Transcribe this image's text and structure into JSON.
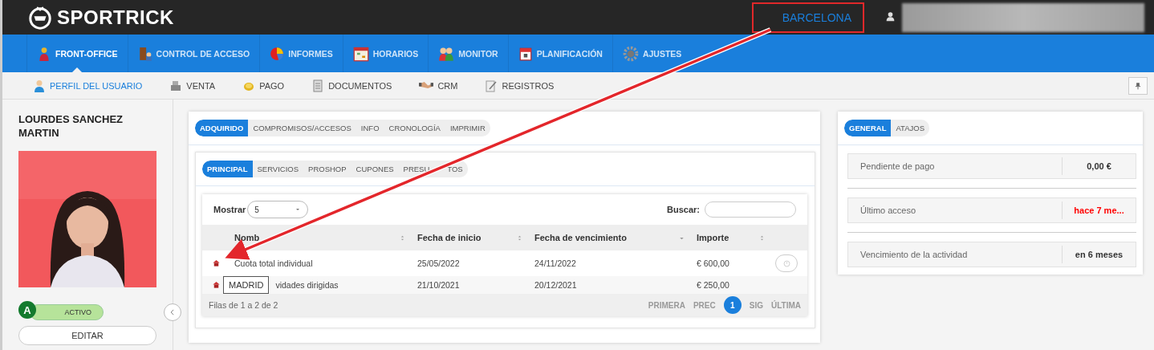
{
  "header": {
    "logo": "SPORTRICK",
    "location": "BARCELONA",
    "location_highlighted": true
  },
  "nav": [
    {
      "label": "FRONT-OFFICE",
      "selected": true
    },
    {
      "label": "CONTROL DE ACCESO",
      "selected": false
    },
    {
      "label": "INFORMES",
      "selected": false
    },
    {
      "label": "HORARIOS",
      "selected": false
    },
    {
      "label": "MONITOR",
      "selected": false
    },
    {
      "label": "PLANIFICACIÓN",
      "selected": false
    },
    {
      "label": "AJUSTES",
      "selected": false
    }
  ],
  "subnav": [
    {
      "label": "PERFIL DEL USUARIO",
      "selected": true
    },
    {
      "label": "VENTA",
      "selected": false
    },
    {
      "label": "PAGO",
      "selected": false
    },
    {
      "label": "DOCUMENTOS",
      "selected": false
    },
    {
      "label": "CRM",
      "selected": false
    },
    {
      "label": "REGISTROS",
      "selected": false
    }
  ],
  "profile": {
    "name": "LOURDES SANCHEZ MARTIN",
    "badge": "A",
    "status": "ACTIVO",
    "active": true,
    "edit": "EDITAR"
  },
  "main": {
    "tabs": [
      {
        "label": "ADQUIRIDO",
        "selected": true
      },
      {
        "label": "COMPROMISOS/ACCESOS",
        "selected": false
      },
      {
        "label": "INFO",
        "selected": false
      },
      {
        "label": "CRONOLOGÍA",
        "selected": false
      },
      {
        "label": "IMPRIMIR",
        "selected": false
      }
    ],
    "subtabs": [
      {
        "label": "PRINCIPAL",
        "selected": true
      },
      {
        "label": "SERVICIOS",
        "selected": false
      },
      {
        "label": "PROSHOP",
        "selected": false
      },
      {
        "label": "CUPONES",
        "selected": false
      },
      {
        "label": "PRESU",
        "label_end": "TOS",
        "selected": false
      }
    ],
    "table": {
      "show_label": "Mostrar",
      "page_size": "5",
      "search_label": "Buscar:",
      "columns": [
        {
          "label": "Nomb"
        },
        {
          "label": "Fecha de inicio"
        },
        {
          "label": "Fecha de vencimiento"
        },
        {
          "label": "Importe"
        }
      ],
      "rows": [
        {
          "name": "Cuota total individual",
          "start": "25/05/2022",
          "end": "24/11/2022",
          "amount": "€ 600,00",
          "action": true
        },
        {
          "tag": "MADRID",
          "name": "vidades dirigidas",
          "start": "21/10/2021",
          "end": "20/12/2021",
          "amount": "€ 250,00",
          "action": false
        }
      ],
      "footer": "Filas de 1 a 2 de 2",
      "pagination": [
        {
          "label": "PRIMERA",
          "selected": false
        },
        {
          "label": "PREC",
          "selected": false
        },
        {
          "label": "1",
          "selected": true
        },
        {
          "label": "SIG",
          "selected": false
        },
        {
          "label": "ÚLTIMA",
          "selected": false
        }
      ]
    }
  },
  "summary": {
    "tabs": [
      {
        "label": "GENERAL",
        "selected": true
      },
      {
        "label": "ATAJOS",
        "selected": false
      }
    ],
    "items": [
      {
        "label": "Pendiente de pago",
        "value": "0,00 €",
        "alert": false
      },
      {
        "label": "Último acceso",
        "value": "hace 7 me...",
        "alert": true
      },
      {
        "label": "Vencimiento de la actividad",
        "value": "en 6 meses",
        "alert": false
      }
    ]
  }
}
